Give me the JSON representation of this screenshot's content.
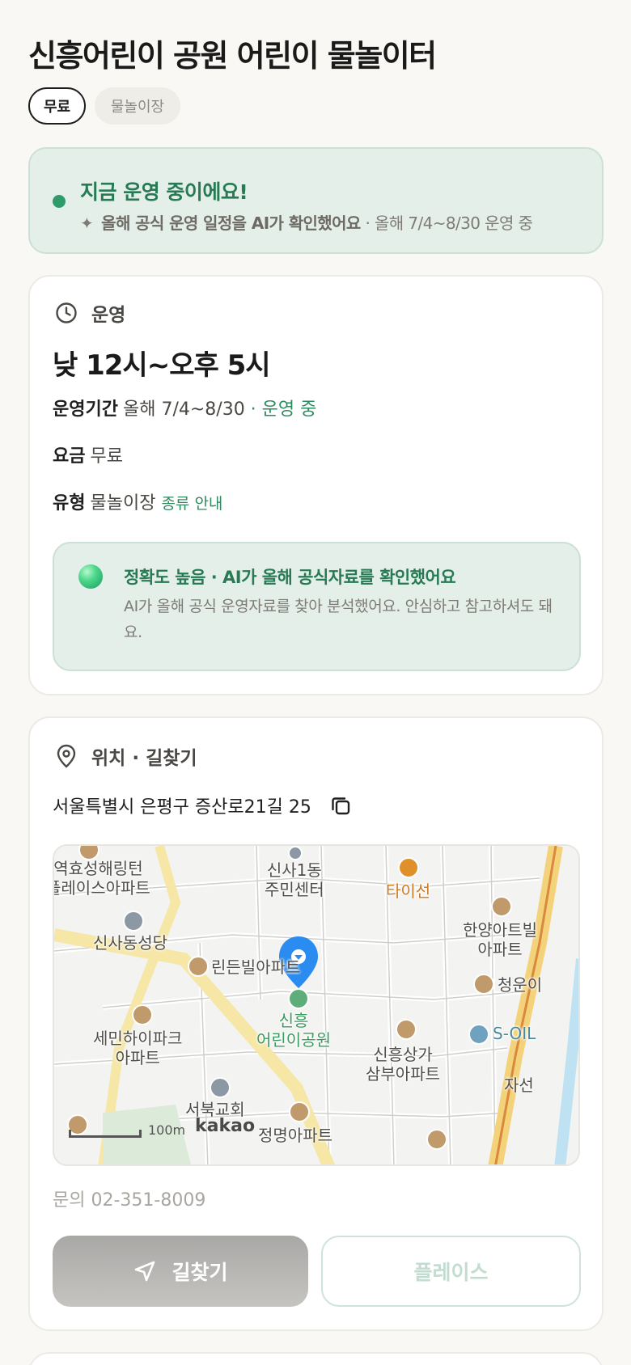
{
  "place": {
    "title": "신흥어린이 공원 어린이 물놀이터",
    "chips": [
      "무료",
      "물놀이장"
    ]
  },
  "status": {
    "title": "지금 운영 중이에요!",
    "sub_bold": "올해 공식 운영 일정을 AI가 확인했어요",
    "sub_rest": " · 올해 7/4~8/30 운영 중",
    "dot_color": "#2f9a6a"
  },
  "operation": {
    "section_label": "운영",
    "hours": "낮 12시~오후 5시",
    "period_key": "운영기간",
    "period_value": "올해 7/4~8/30",
    "period_status": " · 운영 중",
    "fee_key": "요금",
    "fee_value": "무료",
    "type_key": "유형",
    "type_value": "물놀이장",
    "type_link": "종류 안내",
    "accuracy_title": "정확도 높음 · AI가 올해 공식자료를 확인했어요",
    "accuracy_desc": "AI가 올해 공식 운영자료를 찾아 분석했어요. 안심하고 참고하셔도 돼요."
  },
  "location": {
    "section_label": "위치 · 길찾기",
    "address": "서울특별시 은평구 증산로21길 25",
    "map": {
      "labels": {
        "l1": "역효성해링턴\n플레이스아파트",
        "l2": "신사1동\n주민센터",
        "l3": "타이선",
        "l4": "한양아트빌\n아파트",
        "l5": "신사동성당",
        "l6": "린든빌아파트",
        "l7": "청운이",
        "l8": "신흥\n어린이공원",
        "l9": "세민하이파크\n아파트",
        "l10": "신흥상가\n삼부아파트",
        "l11": "S-OIL",
        "l12": "자선",
        "l13": "서북교회",
        "l14": "정명아파트"
      },
      "scale": "100m",
      "brand": "kakao"
    },
    "contact_label": "문의",
    "contact_phone": "02-351-8009",
    "directions_button": "길찾기",
    "place_button": "플레이스"
  }
}
